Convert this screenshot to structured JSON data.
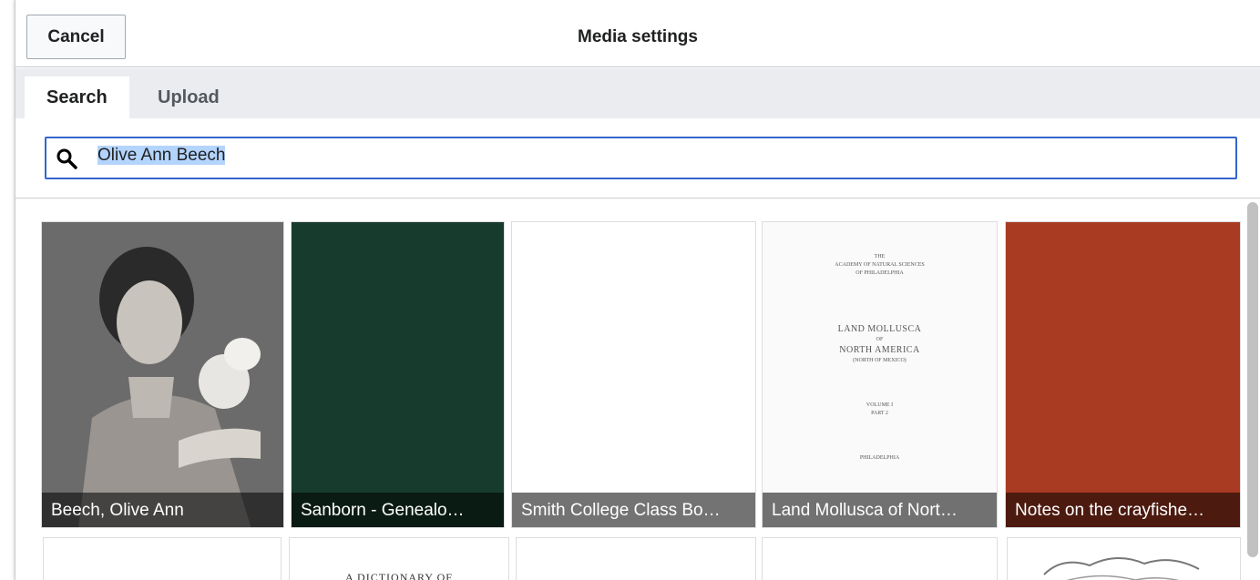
{
  "dialog": {
    "title": "Media settings",
    "cancel_label": "Cancel"
  },
  "tabs": [
    {
      "label": "Search",
      "active": true
    },
    {
      "label": "Upload",
      "active": false
    }
  ],
  "search": {
    "value": "Olive Ann Beech",
    "icon": "search-icon"
  },
  "results": [
    {
      "caption": "Beech, Olive Ann",
      "kind": "photo"
    },
    {
      "caption": "Sanborn - Genealo…",
      "kind": "book-cover"
    },
    {
      "caption": "Smith College Class Bo…",
      "kind": "blank-page"
    },
    {
      "caption": "Land Mollusca of Nort…",
      "kind": "title-page"
    },
    {
      "caption": "Notes on the crayfishe…",
      "kind": "book-cover"
    }
  ],
  "title_page": {
    "lines_small_top": [
      "THE",
      "ACADEMY OF NATURAL SCIENCES",
      "OF PHILADELPHIA"
    ],
    "lines_big": [
      "LAND MOLLUSCA",
      "OF",
      "NORTH AMERICA"
    ],
    "lines_small_bottom": [
      "(NORTH OF MEXICO)",
      "VOLUME I",
      "PART 2",
      "PHILADELPHIA"
    ]
  },
  "row2": [
    {
      "text": ""
    },
    {
      "text": "A DICTIONARY OF"
    },
    {
      "text": ""
    },
    {
      "text": ""
    },
    {
      "text": ""
    }
  ],
  "colors": {
    "accent": "#3366cc",
    "tabs_bg": "#eaecf0"
  }
}
